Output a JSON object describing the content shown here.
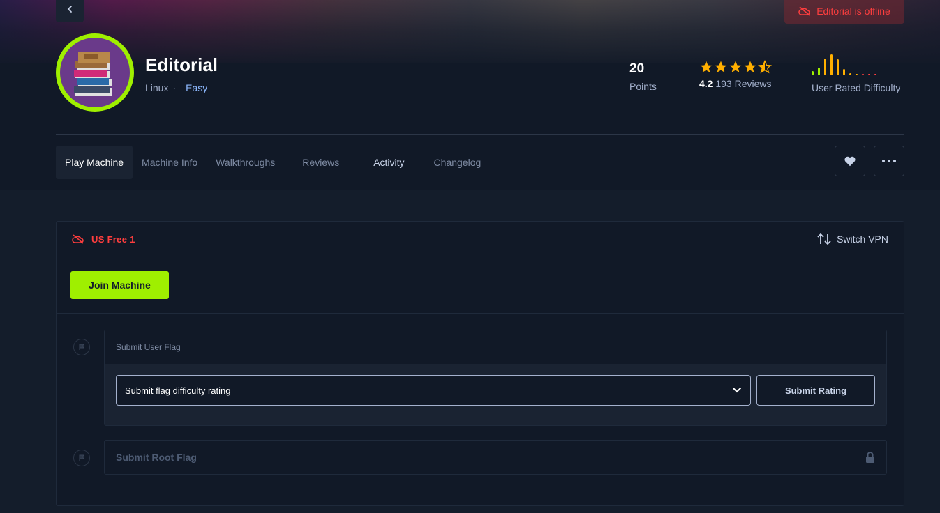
{
  "machine": {
    "name": "Editorial",
    "os": "Linux",
    "separator": "·",
    "difficulty": "Easy",
    "status": "Editorial is offline"
  },
  "stats": {
    "points_value": "20",
    "points_label": "Points",
    "rating_value": "4.2",
    "rating_count": "193 Reviews",
    "stars_filled": 4.5,
    "difficulty_label": "User Rated Difficulty",
    "difficulty_distribution": [
      0.2,
      0.35,
      0.8,
      1.0,
      0.75,
      0.3,
      0.1,
      0.05,
      0.05,
      0.05,
      0.05
    ]
  },
  "tabs": [
    {
      "label": "Play Machine",
      "active": true
    },
    {
      "label": "Machine Info"
    },
    {
      "label": "Walkthroughs"
    },
    {
      "label": "Reviews"
    },
    {
      "label": "Activity"
    },
    {
      "label": "Changelog"
    }
  ],
  "vpn": {
    "server": "US Free 1",
    "switch_label": "Switch VPN"
  },
  "join_label": "Join Machine",
  "user_flag": {
    "title": "Submit User Flag",
    "select_value": "Submit flag difficulty rating",
    "submit_label": "Submit Rating"
  },
  "root_flag": {
    "title": "Submit Root Flag"
  },
  "colors": {
    "accent": "#9fef00",
    "danger": "#ff3e3e",
    "star": "#ffaf00",
    "link": "#8eb9ff"
  }
}
